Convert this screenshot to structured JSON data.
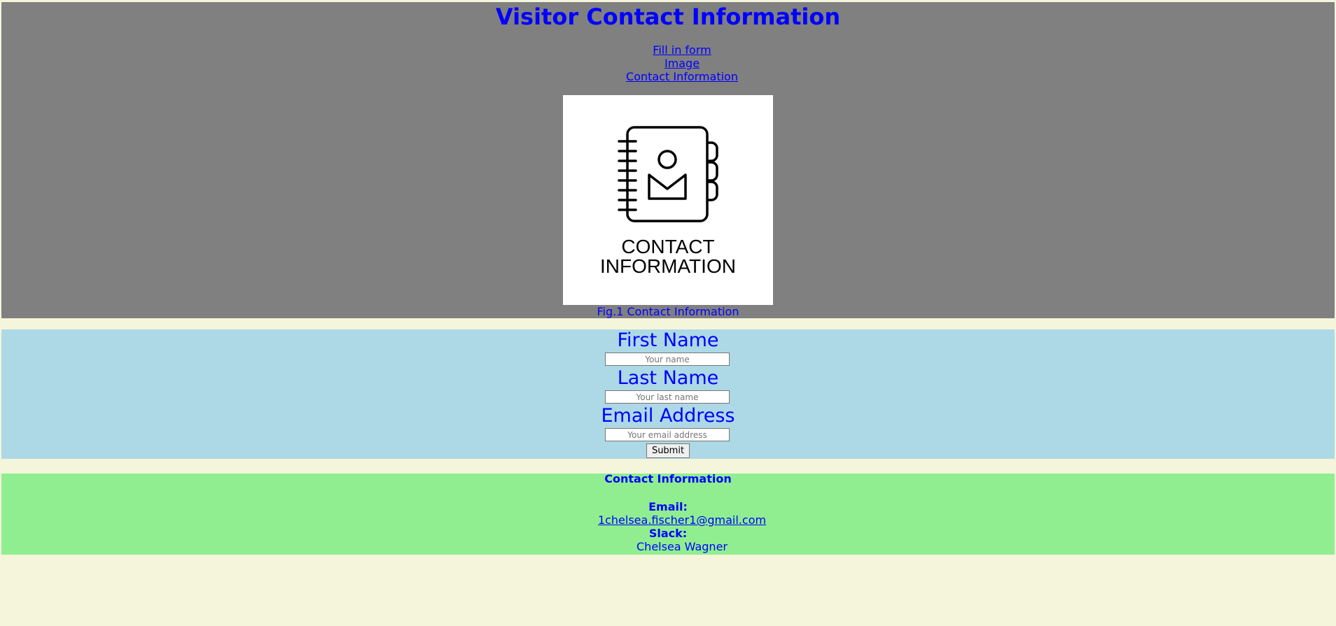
{
  "header": {
    "title": "Visitor Contact Information",
    "nav": [
      {
        "label": "Fill in form"
      },
      {
        "label": "Image"
      },
      {
        "label": "Contact Information"
      }
    ],
    "figure": {
      "image_text_line1": "CONTACT",
      "image_text_line2": "INFORMATION",
      "caption": "Fig.1 Contact Information",
      "icon": "address-book-icon"
    }
  },
  "form": {
    "first_name_label": "First Name",
    "first_name_placeholder": "Your name",
    "last_name_label": "Last Name",
    "last_name_placeholder": "Your last name",
    "email_label": "Email Address",
    "email_placeholder": "Your email address",
    "submit_label": "Submit"
  },
  "contact": {
    "heading": "Contact Information",
    "email_label": "Email:",
    "email_value": "1chelsea.fischer1@gmail.com",
    "slack_label": "Slack:",
    "slack_value": "Chelsea Wagner"
  },
  "colors": {
    "page_background": "#f5f5dc",
    "header_background": "#808080",
    "form_background": "#add8e6",
    "contact_background": "#90ee90",
    "text": "#0000ff"
  }
}
